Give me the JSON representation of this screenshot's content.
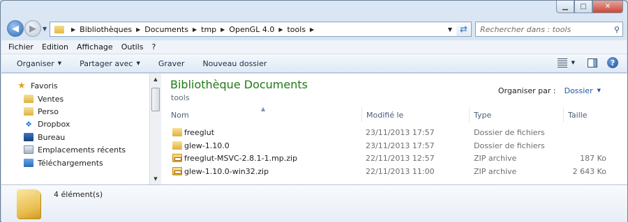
{
  "window": {
    "controls": {
      "minimize": "▁",
      "maximize": "□",
      "close": "✕"
    }
  },
  "address": {
    "crumbs": [
      "Bibliothèques",
      "Documents",
      "tmp",
      "OpenGL 4.0",
      "tools"
    ],
    "dropdown_icon": "chevron-down-icon",
    "refresh_icon": "refresh-icon"
  },
  "search": {
    "placeholder": "Rechercher dans : tools"
  },
  "menu": [
    "Fichier",
    "Edition",
    "Affichage",
    "Outils",
    "?"
  ],
  "toolbar": {
    "organize": "Organiser",
    "share": "Partager avec",
    "burn": "Graver",
    "new_folder": "Nouveau dossier"
  },
  "sidebar": {
    "favorites": "Favoris",
    "items": [
      "Ventes",
      "Perso",
      "Dropbox",
      "Bureau",
      "Emplacements récents",
      "Téléchargements"
    ]
  },
  "content": {
    "title": "Bibliothèque Documents",
    "subtitle": "tools",
    "arrange_label": "Organiser par :",
    "arrange_value": "Dossier",
    "columns": [
      "Nom",
      "Modifié le",
      "Type",
      "Taille"
    ],
    "rows": [
      {
        "name": "freeglut",
        "date": "23/11/2013 17:57",
        "type": "Dossier de fichiers",
        "size": "",
        "icon": "folder-icon"
      },
      {
        "name": "glew-1.10.0",
        "date": "23/11/2013 17:57",
        "type": "Dossier de fichiers",
        "size": "",
        "icon": "folder-icon"
      },
      {
        "name": "freeglut-MSVC-2.8.1-1.mp.zip",
        "date": "22/11/2013 12:57",
        "type": "ZIP archive",
        "size": "187 Ko",
        "icon": "zip-icon"
      },
      {
        "name": "glew-1.10.0-win32.zip",
        "date": "22/11/2013 11:00",
        "type": "ZIP archive",
        "size": "2 643 Ko",
        "icon": "zip-icon"
      }
    ]
  },
  "details": {
    "count": "4 élément(s)"
  }
}
